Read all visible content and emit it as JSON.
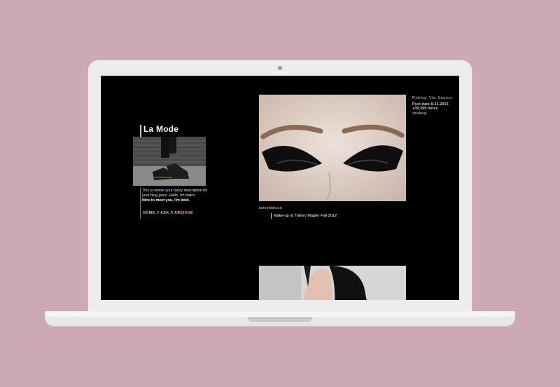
{
  "blog": {
    "title": "La Mode",
    "description_plain": "This is where your fancy description for your blog goes. ",
    "description_italic": "Hello, I'm italics",
    "description_bold": "Nice to meet you, I'm bold.",
    "nav": [
      "HOME",
      "ASK",
      "ARCHIVE"
    ],
    "nav_separator": " // "
  },
  "post": {
    "actions": [
      "Reblog",
      "Via",
      "Source"
    ],
    "date": "Post date 8.31.2015",
    "notes": "+39,399 notes",
    "tag": "#makeup",
    "username": "lamorbidezza",
    "caption": "Make-up at Thierry Mugler Fall 2012"
  },
  "colors": {
    "background": "#cda9b3",
    "screen": "#000000",
    "accent": "#e8b8c6"
  }
}
